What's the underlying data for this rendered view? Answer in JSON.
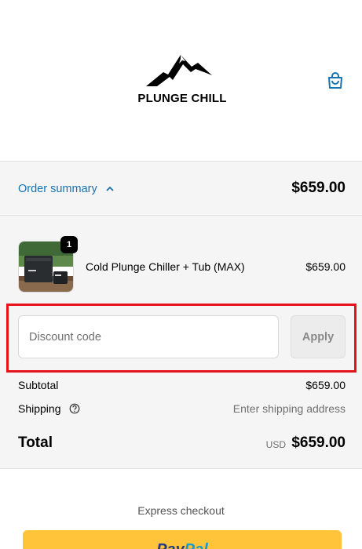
{
  "header": {
    "logo_text": "PLUNGE CHILL",
    "cart_icon": "shopping-bag-icon"
  },
  "order_summary": {
    "toggle_label": "Order summary",
    "toggle_icon": "chevron-up-icon",
    "total": "$659.00",
    "link_color": "#1773b0"
  },
  "product": {
    "quantity": "1",
    "name": "Cold Plunge Chiller + Tub (MAX)",
    "price": "$659.00"
  },
  "discount": {
    "placeholder": "Discount code",
    "apply_label": "Apply",
    "highlight_color": "#e5141b"
  },
  "totals": {
    "subtotal_label": "Subtotal",
    "subtotal_value": "$659.00",
    "shipping_label": "Shipping",
    "shipping_help_icon": "question-circle-icon",
    "shipping_value": "Enter shipping address",
    "total_label": "Total",
    "currency": "USD",
    "total_value": "$659.00"
  },
  "express": {
    "label": "Express checkout",
    "paypal_part1": "Pay",
    "paypal_part2": "Pal",
    "paypal_color": "#ffc439"
  }
}
